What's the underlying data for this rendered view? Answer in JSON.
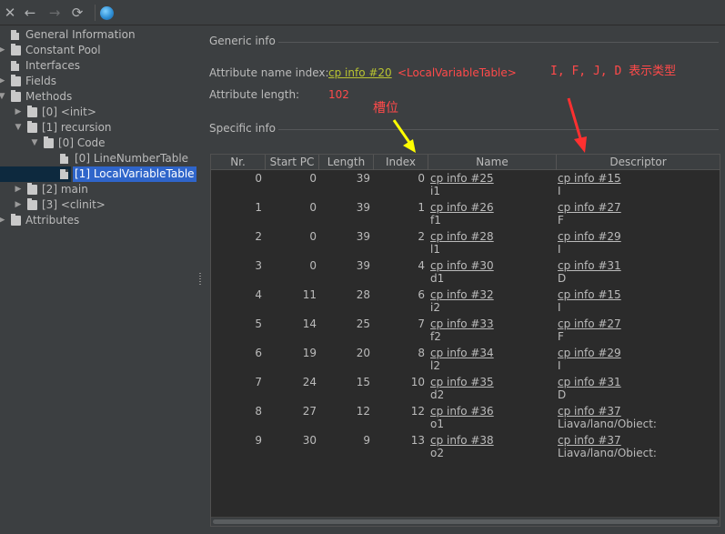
{
  "toolbar": {
    "close": "✕",
    "back": "←",
    "forward": "→",
    "refresh": "⟳"
  },
  "tree": [
    {
      "label": "General Information",
      "kind": "file",
      "depth": 0,
      "arrow": ""
    },
    {
      "label": "Constant Pool",
      "kind": "folder",
      "depth": 0,
      "arrow": "▶"
    },
    {
      "label": "Interfaces",
      "kind": "file",
      "depth": 0,
      "arrow": ""
    },
    {
      "label": "Fields",
      "kind": "folder",
      "depth": 0,
      "arrow": "▶"
    },
    {
      "label": "Methods",
      "kind": "folder",
      "depth": 0,
      "arrow": "▼"
    },
    {
      "label": "[0] <init>",
      "kind": "folder",
      "depth": 1,
      "arrow": "▶"
    },
    {
      "label": "[1] recursion",
      "kind": "folder",
      "depth": 1,
      "arrow": "▼"
    },
    {
      "label": "[0] Code",
      "kind": "folder",
      "depth": 2,
      "arrow": "▼"
    },
    {
      "label": "[0] LineNumberTable",
      "kind": "file",
      "depth": 3,
      "arrow": ""
    },
    {
      "label": "[1] LocalVariableTable",
      "kind": "file",
      "depth": 3,
      "arrow": "",
      "selected": true
    },
    {
      "label": "[2] main",
      "kind": "folder",
      "depth": 1,
      "arrow": "▶"
    },
    {
      "label": "[3] <clinit>",
      "kind": "folder",
      "depth": 1,
      "arrow": "▶"
    },
    {
      "label": "Attributes",
      "kind": "folder",
      "depth": 0,
      "arrow": "▶"
    }
  ],
  "generic": {
    "title": "Generic info",
    "name_index_label": "Attribute name index:",
    "name_index_link": "cp info #20",
    "name_index_value": "<LocalVariableTable>",
    "length_label": "Attribute length:",
    "length_value": "102"
  },
  "specific": {
    "title": "Specific info"
  },
  "table": {
    "columns": [
      "Nr.",
      "Start PC",
      "Length",
      "Index",
      "Name",
      "Descriptor"
    ],
    "rows": [
      {
        "nr": "0",
        "start": "0",
        "length": "39",
        "index": "0",
        "name": "cp info #25",
        "name_sub": "i1",
        "desc": "cp info #15",
        "desc_sub": "I"
      },
      {
        "nr": "1",
        "start": "0",
        "length": "39",
        "index": "1",
        "name": "cp info #26",
        "name_sub": "f1",
        "desc": "cp info #27",
        "desc_sub": "F"
      },
      {
        "nr": "2",
        "start": "0",
        "length": "39",
        "index": "2",
        "name": "cp info #28",
        "name_sub": "l1",
        "desc": "cp info #29",
        "desc_sub": "J"
      },
      {
        "nr": "3",
        "start": "0",
        "length": "39",
        "index": "4",
        "name": "cp info #30",
        "name_sub": "d1",
        "desc": "cp info #31",
        "desc_sub": "D"
      },
      {
        "nr": "4",
        "start": "11",
        "length": "28",
        "index": "6",
        "name": "cp info #32",
        "name_sub": "i2",
        "desc": "cp info #15",
        "desc_sub": "I"
      },
      {
        "nr": "5",
        "start": "14",
        "length": "25",
        "index": "7",
        "name": "cp info #33",
        "name_sub": "f2",
        "desc": "cp info #27",
        "desc_sub": "F"
      },
      {
        "nr": "6",
        "start": "19",
        "length": "20",
        "index": "8",
        "name": "cp info #34",
        "name_sub": "l2",
        "desc": "cp info #29",
        "desc_sub": "J"
      },
      {
        "nr": "7",
        "start": "24",
        "length": "15",
        "index": "10",
        "name": "cp info #35",
        "name_sub": "d2",
        "desc": "cp info #31",
        "desc_sub": "D"
      },
      {
        "nr": "8",
        "start": "27",
        "length": "12",
        "index": "12",
        "name": "cp info #36",
        "name_sub": "o1",
        "desc": "cp info #37",
        "desc_sub": "Ljava/lang/Object;"
      },
      {
        "nr": "9",
        "start": "30",
        "length": "9",
        "index": "13",
        "name": "cp info #38",
        "name_sub": "o2",
        "desc": "cp info #37",
        "desc_sub": "Ljava/lang/Object;"
      }
    ]
  },
  "annotations": {
    "slot": "槽位",
    "types": "I, F, J, D  表示类型",
    "slot_arrow_color": "#ffff00",
    "types_arrow_color": "#ff3030"
  }
}
